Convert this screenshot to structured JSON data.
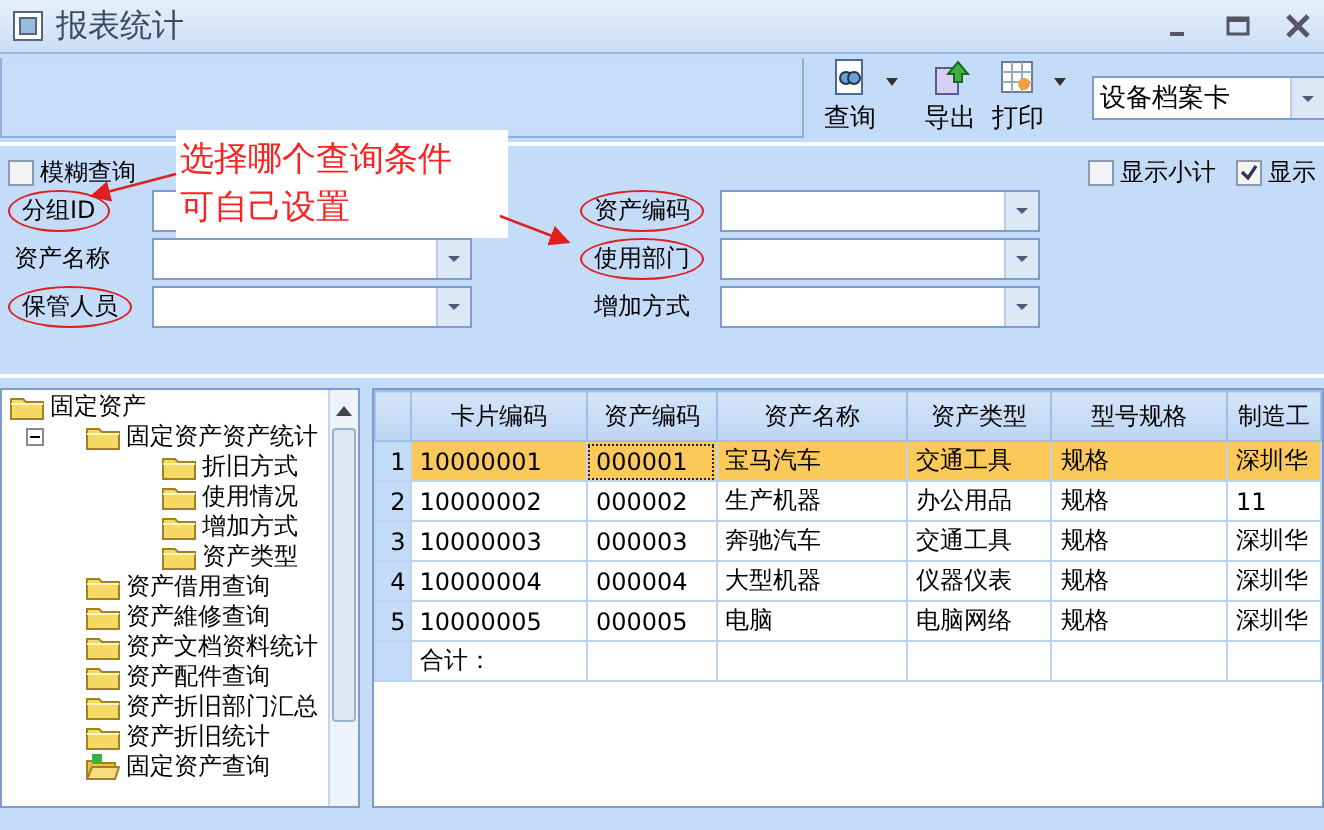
{
  "window": {
    "title": "报表统计"
  },
  "toolbar": {
    "buttons": [
      {
        "label": "查询",
        "kind": "query",
        "dropdown": true
      },
      {
        "label": "导出",
        "kind": "export",
        "dropdown": false
      },
      {
        "label": "打印",
        "kind": "print",
        "dropdown": true
      }
    ],
    "report_select": {
      "value": "设备档案卡"
    }
  },
  "filters": {
    "fuzzy": {
      "label": "模糊查询",
      "checked": false
    },
    "options": [
      {
        "label": "显示小计",
        "checked": false
      },
      {
        "label": "显示",
        "checked": true
      }
    ],
    "fields": [
      {
        "label": "分组ID",
        "circled": true
      },
      {
        "label": "资产编码",
        "circled": true
      },
      {
        "label": "资产名称",
        "circled": false
      },
      {
        "label": "使用部门",
        "circled": true
      },
      {
        "label": "保管人员",
        "circled": true
      },
      {
        "label": "增加方式",
        "circled": false
      }
    ]
  },
  "annotation": {
    "lines": [
      "选择哪个查询条件",
      "可自己设置"
    ]
  },
  "tree": [
    {
      "label": "固定资产",
      "kind": "folder",
      "children": [
        {
          "label": "固定资产资产统计",
          "kind": "folder",
          "expanded": true,
          "children": [
            {
              "label": "折旧方式",
              "kind": "folder"
            },
            {
              "label": "使用情况",
              "kind": "folder"
            },
            {
              "label": "增加方式",
              "kind": "folder"
            },
            {
              "label": "资产类型",
              "kind": "folder"
            }
          ]
        },
        {
          "label": "资产借用查询",
          "kind": "folder"
        },
        {
          "label": "资产維修查询",
          "kind": "folder"
        },
        {
          "label": "资产文档资料统计",
          "kind": "folder"
        },
        {
          "label": "资产配件查询",
          "kind": "folder"
        },
        {
          "label": "资产折旧部门汇总",
          "kind": "folder"
        },
        {
          "label": "资产折旧统计",
          "kind": "folder"
        },
        {
          "label": "固定资产查询",
          "kind": "report"
        }
      ]
    }
  ],
  "table": {
    "columns": [
      "卡片编码",
      "资产编码",
      "资产名称",
      "资产类型",
      "型号规格",
      "制造工"
    ],
    "rows": [
      {
        "number": "1",
        "selected": true,
        "cells": [
          "10000001",
          "000001",
          "宝马汽车",
          "交通工具",
          "规格",
          "深圳华"
        ]
      },
      {
        "number": "2",
        "selected": false,
        "cells": [
          "10000002",
          "000002",
          "生产机器",
          "办公用品",
          "规格",
          "11"
        ]
      },
      {
        "number": "3",
        "selected": false,
        "cells": [
          "10000003",
          "000003",
          "奔驰汽车",
          "交通工具",
          "规格",
          "深圳华"
        ]
      },
      {
        "number": "4",
        "selected": false,
        "cells": [
          "10000004",
          "000004",
          "大型机器",
          "仪器仪表",
          "规格",
          "深圳华"
        ]
      },
      {
        "number": "5",
        "selected": false,
        "cells": [
          "10000005",
          "000005",
          "电脑",
          "电脑网络",
          "规格",
          "深圳华"
        ]
      }
    ],
    "total_label": "合计："
  }
}
